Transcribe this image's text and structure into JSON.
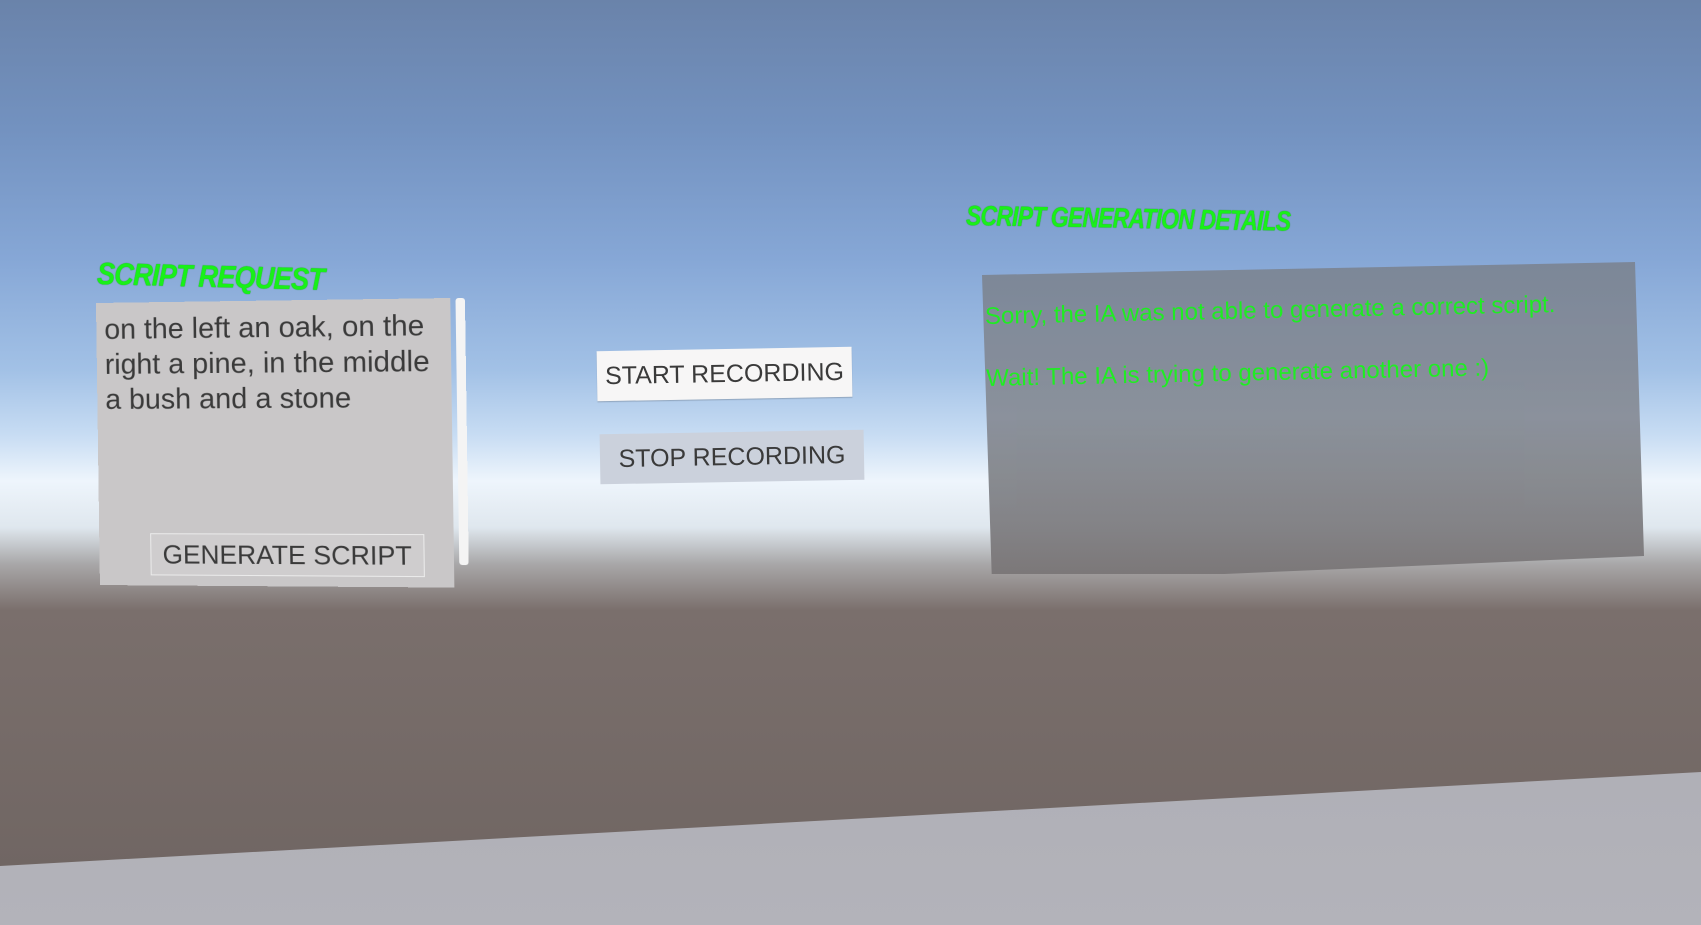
{
  "script_request": {
    "label": "SCRIPT REQUEST",
    "text": "on the left an oak, on the right a pine, in the middle a bush and a stone",
    "generate_label": "GENERATE SCRIPT"
  },
  "recording": {
    "start_label": "START RECORDING",
    "stop_label": "STOP RECORDING"
  },
  "details": {
    "label": "SCRIPT GENERATION DETAILS",
    "message_line1": "Sorry, the IA was not able to generate a correct script.",
    "message_line2": "Wait! The IA is trying to generate another one :)"
  },
  "colors": {
    "accent_green": "#19f019",
    "panel_gray": "#c9c7c8",
    "details_panel": "#848b96"
  }
}
